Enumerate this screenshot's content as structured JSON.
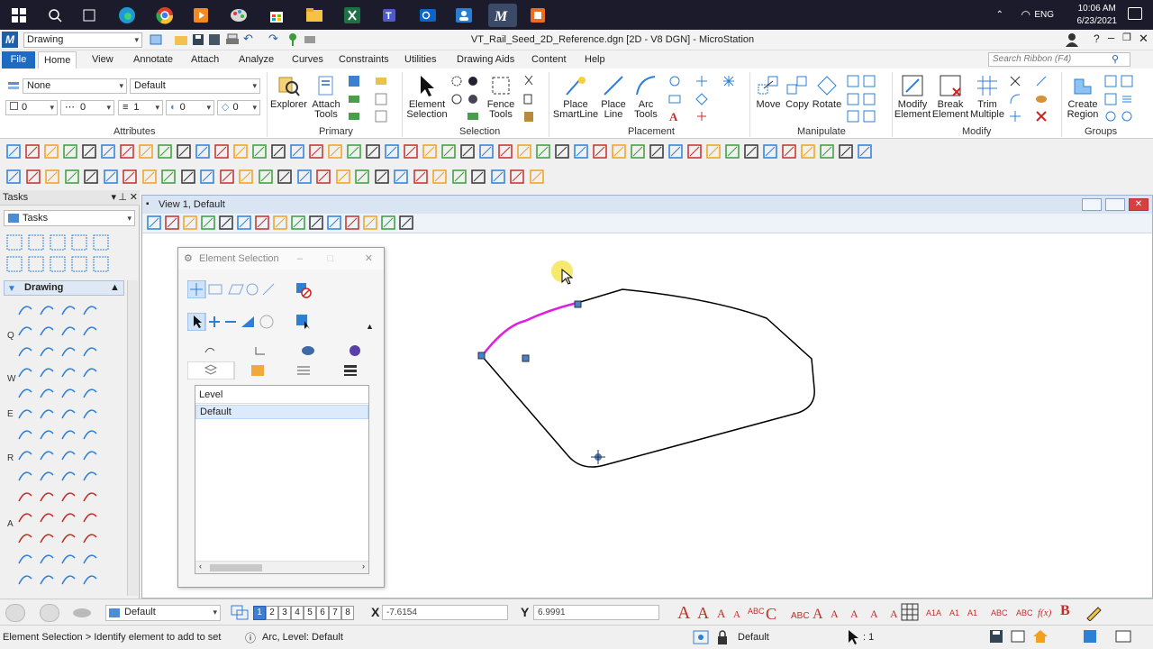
{
  "taskbar": {
    "language": "ENG",
    "time": "10:06 AM",
    "date": "6/23/2021"
  },
  "titlebar": {
    "workflow": "Drawing",
    "window_title": "VT_Rail_Seed_2D_Reference.dgn [2D - V8 DGN] - MicroStation"
  },
  "ribbon_tabs": [
    "File",
    "Home",
    "View",
    "Annotate",
    "Attach",
    "Analyze",
    "Curves",
    "Constraints",
    "Utilities",
    "Drawing Aids",
    "Content",
    "Help"
  ],
  "ribbon_search_placeholder": "Search Ribbon (F4)",
  "attributes": {
    "level": "None",
    "style": "Default",
    "color": "0",
    "weight_a": "0",
    "weight_b": "1",
    "transp": "0",
    "priority": "0"
  },
  "groups": {
    "attributes": "Attributes",
    "primary": "Primary",
    "selection": "Selection",
    "placement": "Placement",
    "manipulate": "Manipulate",
    "modify": "Modify",
    "groups": "Groups"
  },
  "buttons": {
    "explorer": "Explorer",
    "attach_tools_1": "Attach",
    "attach_tools_2": "Tools",
    "element_selection_1": "Element",
    "element_selection_2": "Selection",
    "fence_tools_1": "Fence",
    "fence_tools_2": "Tools",
    "place_smartline_1": "Place",
    "place_smartline_2": "SmartLine",
    "place_line_1": "Place",
    "place_line_2": "Line",
    "arc_tools_1": "Arc",
    "arc_tools_2": "Tools",
    "move": "Move",
    "copy": "Copy",
    "rotate": "Rotate",
    "modify_element_1": "Modify",
    "modify_element_2": "Element",
    "break_element_1": "Break",
    "break_element_2": "Element",
    "trim_multiple_1": "Trim",
    "trim_multiple_2": "Multiple",
    "create_region_1": "Create",
    "create_region_2": "Region"
  },
  "tasks_panel": {
    "title": "Tasks",
    "combo": "Tasks",
    "section": "Drawing",
    "side_letters": [
      "Q",
      "W",
      "E",
      "R",
      "A"
    ]
  },
  "view": {
    "title": "View 1, Default"
  },
  "element_selection_dialog": {
    "title": "Element Selection",
    "list_header": "Level",
    "list_row": "Default"
  },
  "bottom_bar": {
    "level": "Default",
    "view_numbers": [
      "1",
      "2",
      "3",
      "4",
      "5",
      "6",
      "7",
      "8"
    ],
    "x_label": "X",
    "x_value": "-7.6154",
    "y_label": "Y",
    "y_value": "6.9991"
  },
  "status_bar": {
    "prompt": "Element Selection > Identify element to add to set",
    "element_info": "Arc, Level: Default",
    "active_level": "Default",
    "scale": ": 1"
  },
  "colors": {
    "accent": "#1f6bc1",
    "highlight_arc": "#e01ee0",
    "cursor_halo": "#f5e44a"
  }
}
